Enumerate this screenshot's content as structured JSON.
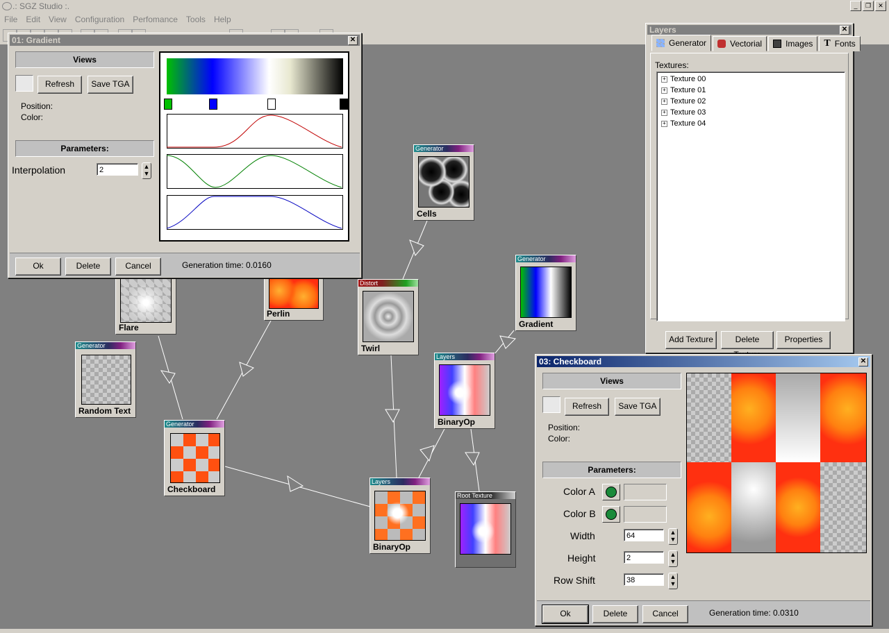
{
  "app": {
    "title": ".: SGZ Studio :.",
    "icon": "eye-icon"
  },
  "menu": [
    "File",
    "Edit",
    "View",
    "Configuration",
    "Perfomance",
    "Tools",
    "Help"
  ],
  "nodes": {
    "flare": {
      "label": "Flare"
    },
    "perlin": {
      "label": "Perlin"
    },
    "cells": {
      "category": "Generator",
      "label": "Cells"
    },
    "twirl": {
      "category": "Distort",
      "label": "Twirl"
    },
    "gradient": {
      "category": "Generator",
      "label": "Gradient"
    },
    "random_text": {
      "category": "Generator",
      "label": "Random Text"
    },
    "checkboard": {
      "category": "Generator",
      "label": "Checkboard"
    },
    "binaryop1": {
      "category": "Layers",
      "label": "BinaryOp"
    },
    "binaryop2": {
      "category": "Layers",
      "label": "BinaryOp"
    },
    "root": {
      "category": "Root Texture",
      "label": ""
    }
  },
  "gradient_dialog": {
    "title": "01: Gradient",
    "views": "Views",
    "refresh": "Refresh",
    "save_tga": "Save TGA",
    "position_label": "Position:",
    "color_label": "Color:",
    "parameters": "Parameters:",
    "interpolation_label": "Interpolation",
    "interpolation_value": "2",
    "ok": "Ok",
    "delete": "Delete",
    "cancel": "Cancel",
    "generation_time": "Generation time: 0.0160",
    "stops": [
      "#00c000",
      "#0000ff",
      "#ffffff",
      "#000000"
    ]
  },
  "layers_panel": {
    "title": "Layers",
    "tabs": [
      {
        "label": "Generator",
        "icon": "checker-icon"
      },
      {
        "label": "Vectorial",
        "icon": "brush-icon"
      },
      {
        "label": "Images",
        "icon": "image-icon"
      },
      {
        "label": "Fonts",
        "icon": "font-icon"
      }
    ],
    "textures_label": "Textures:",
    "textures": [
      "Texture 00",
      "Texture 01",
      "Texture 02",
      "Texture 03",
      "Texture 04"
    ],
    "add_texture": "Add Texture",
    "delete_texture": "Delete Texture",
    "properties": "Properties"
  },
  "checkboard_dialog": {
    "title": "03: Checkboard",
    "views": "Views",
    "refresh": "Refresh",
    "save_tga": "Save TGA",
    "position_label": "Position:",
    "color_label": "Color:",
    "parameters": "Parameters:",
    "color_a_label": "Color A",
    "color_b_label": "Color B",
    "width_label": "Width",
    "width_value": "64",
    "height_label": "Height",
    "height_value": "2",
    "row_shift_label": "Row Shift",
    "row_shift_value": "38",
    "ok": "Ok",
    "delete": "Delete",
    "cancel": "Cancel",
    "generation_time": "Generation time: 0.0310"
  },
  "colors": {
    "active_caption": "#0a246a",
    "inactive_caption": "#808080",
    "face": "#d4d0c8",
    "workspace": "#808080"
  }
}
